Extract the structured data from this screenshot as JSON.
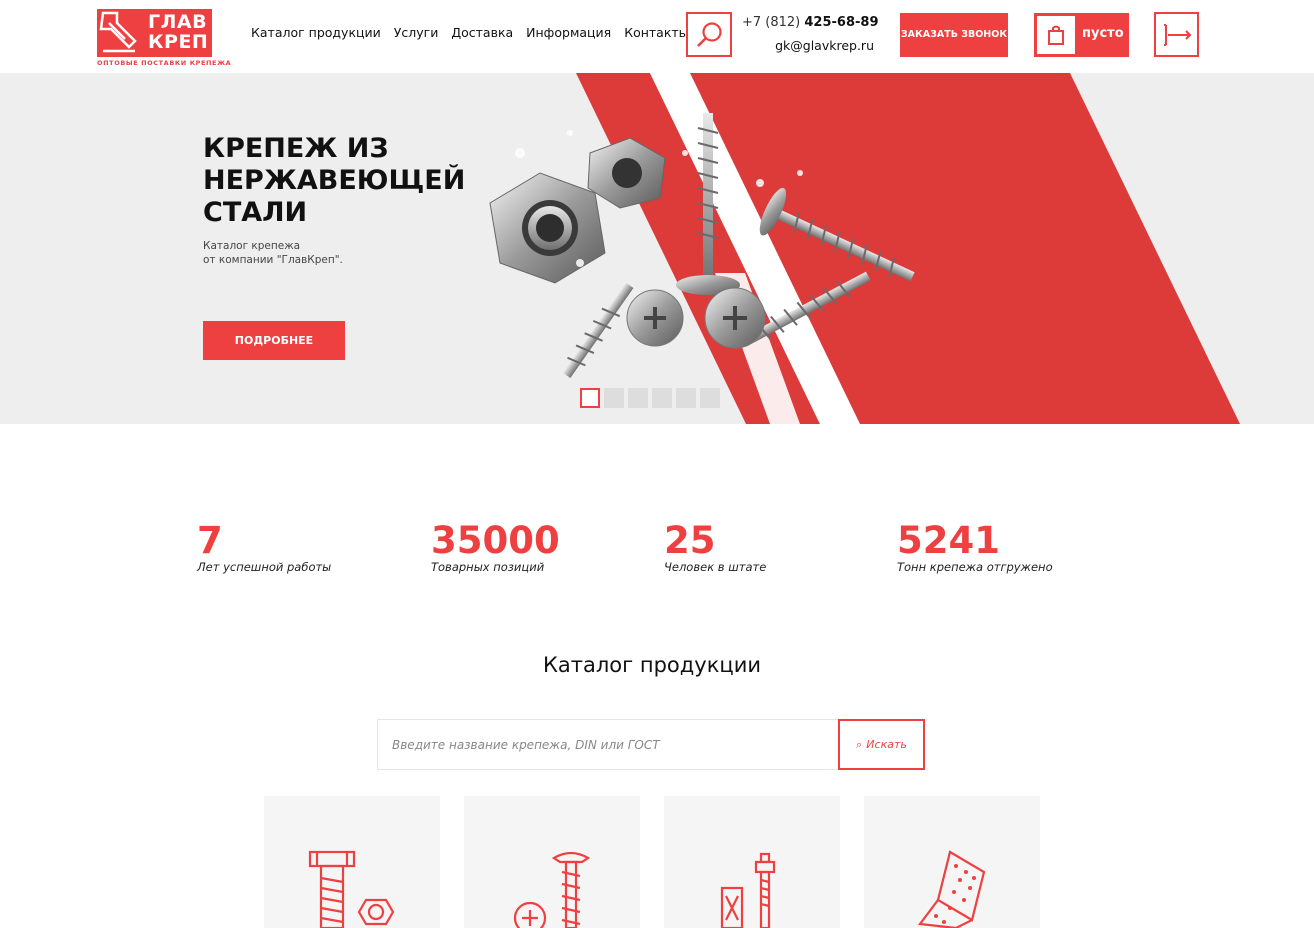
{
  "brand": {
    "logo_line1": "ГЛАВ",
    "logo_line2": "КРЕП",
    "tagline": "ОПТОВЫЕ ПОСТАВКИ КРЕПЕЖА",
    "accent": "#ee4040"
  },
  "nav": {
    "items": [
      {
        "label": "Каталог продукции"
      },
      {
        "label": "Услуги"
      },
      {
        "label": "Доставка"
      },
      {
        "label": "Информация"
      },
      {
        "label": "Контакты"
      }
    ]
  },
  "header": {
    "search_icon": "magnifier-icon",
    "phone_prefix": "+7 (812) ",
    "phone_number": "425-68-89",
    "email": "gk@glavkrep.ru",
    "call_button": "ЗАКАЗАТЬ ЗВОНОК",
    "cart_label": "пусто",
    "cart_icon": "shopping-bag-icon",
    "login_icon": "login-arrow-icon"
  },
  "hero": {
    "title": "КРЕПЕЖ ИЗ НЕРЖАВЕЮЩЕЙ СТАЛИ",
    "subtitle": "Каталог крепежа\nот компании \"ГлавКреп\".",
    "button": "ПОДРОБНЕЕ",
    "slides_total": 6,
    "slide_active": 1
  },
  "stats": [
    {
      "value": "7",
      "label": "Лет успешной работы"
    },
    {
      "value": "35000",
      "label": "Товарных позиций"
    },
    {
      "value": "25",
      "label": "Человек в штате"
    },
    {
      "value": "5241",
      "label": "Тонн крепежа отгружено"
    }
  ],
  "catalog": {
    "title": "Каталог продукции",
    "search_placeholder": "Введите название крепежа, DIN или ГОСТ",
    "search_button": "Искать",
    "categories": [
      {
        "icon": "bolt-nut-icon"
      },
      {
        "icon": "screw-rivet-icon"
      },
      {
        "icon": "anchor-icon"
      },
      {
        "icon": "perforated-corner-icon"
      }
    ]
  }
}
